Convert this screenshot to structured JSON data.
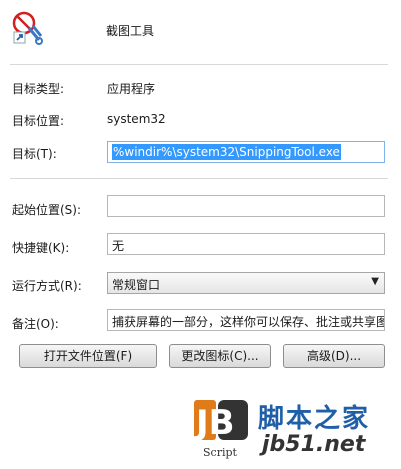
{
  "header": {
    "app_name": "截图工具"
  },
  "rows": {
    "target_type_label": "目标类型:",
    "target_type_value": "应用程序",
    "target_location_label": "目标位置:",
    "target_location_value": "system32",
    "target_label": "目标(T):",
    "target_value": "%windir%\\system32\\SnippingTool.exe",
    "start_in_label": "起始位置(S):",
    "start_in_value": "",
    "shortcut_key_label": "快捷键(K):",
    "shortcut_key_value": "无",
    "run_label": "运行方式(R):",
    "run_value": "常规窗口",
    "comment_label": "备注(O):",
    "comment_value": "捕获屏幕的一部分，这样你可以保存、批注或共享图"
  },
  "buttons": {
    "open_location": "打开文件位置(F)",
    "change_icon": "更改图标(C)...",
    "advanced": "高级(D)..."
  },
  "watermark": {
    "jb": "JB",
    "script": "Script",
    "site_name": "脚本之家",
    "url": "jb51.net"
  },
  "colors": {
    "selection": "#3399ff",
    "watermark_orange": "#e07b1a",
    "watermark_blue": "#1f5fa8"
  }
}
